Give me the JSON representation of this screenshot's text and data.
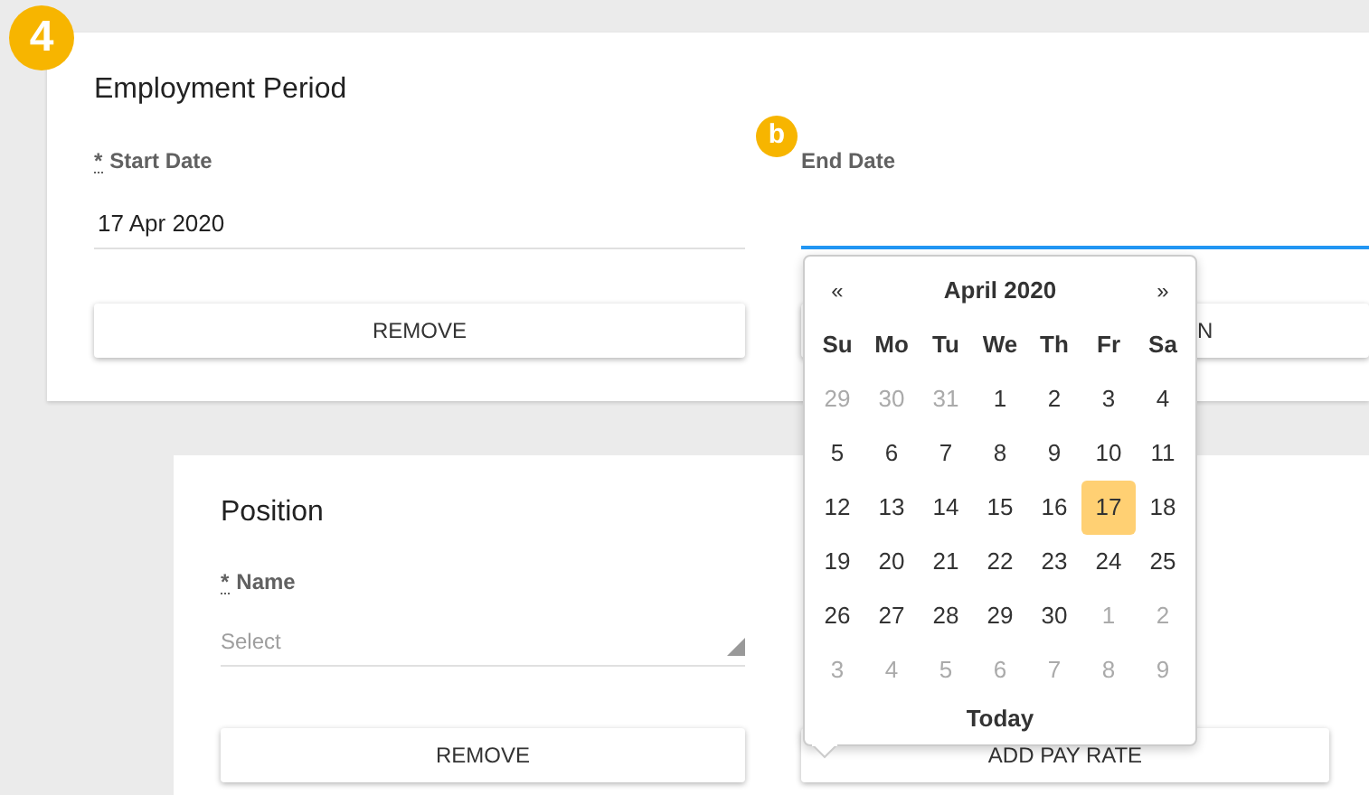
{
  "step_badge": "4",
  "field_badge": "b",
  "employment_period": {
    "title": "Employment Period",
    "start_date": {
      "required_mark": "*",
      "label": "Start Date",
      "value": "17 Apr 2020"
    },
    "end_date": {
      "label": "End Date",
      "focused": true
    },
    "remove_button": "REMOVE",
    "right_button": "N"
  },
  "position": {
    "title": "Position",
    "name": {
      "required_mark": "*",
      "label": "Name",
      "placeholder": "Select"
    },
    "remove_button": "REMOVE",
    "right_button": "ADD PAY RATE"
  },
  "datepicker": {
    "prev": "«",
    "month": "April 2020",
    "next": "»",
    "weekdays": [
      "Su",
      "Mo",
      "Tu",
      "We",
      "Th",
      "Fr",
      "Sa"
    ],
    "weeks": [
      [
        {
          "day": "29",
          "outside": true,
          "selected": false
        },
        {
          "day": "30",
          "outside": true,
          "selected": false
        },
        {
          "day": "31",
          "outside": true,
          "selected": false
        },
        {
          "day": "1",
          "outside": false,
          "selected": false
        },
        {
          "day": "2",
          "outside": false,
          "selected": false
        },
        {
          "day": "3",
          "outside": false,
          "selected": false
        },
        {
          "day": "4",
          "outside": false,
          "selected": false
        }
      ],
      [
        {
          "day": "5",
          "outside": false,
          "selected": false
        },
        {
          "day": "6",
          "outside": false,
          "selected": false
        },
        {
          "day": "7",
          "outside": false,
          "selected": false
        },
        {
          "day": "8",
          "outside": false,
          "selected": false
        },
        {
          "day": "9",
          "outside": false,
          "selected": false
        },
        {
          "day": "10",
          "outside": false,
          "selected": false
        },
        {
          "day": "11",
          "outside": false,
          "selected": false
        }
      ],
      [
        {
          "day": "12",
          "outside": false,
          "selected": false
        },
        {
          "day": "13",
          "outside": false,
          "selected": false
        },
        {
          "day": "14",
          "outside": false,
          "selected": false
        },
        {
          "day": "15",
          "outside": false,
          "selected": false
        },
        {
          "day": "16",
          "outside": false,
          "selected": false
        },
        {
          "day": "17",
          "outside": false,
          "selected": true
        },
        {
          "day": "18",
          "outside": false,
          "selected": false
        }
      ],
      [
        {
          "day": "19",
          "outside": false,
          "selected": false
        },
        {
          "day": "20",
          "outside": false,
          "selected": false
        },
        {
          "day": "21",
          "outside": false,
          "selected": false
        },
        {
          "day": "22",
          "outside": false,
          "selected": false
        },
        {
          "day": "23",
          "outside": false,
          "selected": false
        },
        {
          "day": "24",
          "outside": false,
          "selected": false
        },
        {
          "day": "25",
          "outside": false,
          "selected": false
        }
      ],
      [
        {
          "day": "26",
          "outside": false,
          "selected": false
        },
        {
          "day": "27",
          "outside": false,
          "selected": false
        },
        {
          "day": "28",
          "outside": false,
          "selected": false
        },
        {
          "day": "29",
          "outside": false,
          "selected": false
        },
        {
          "day": "30",
          "outside": false,
          "selected": false
        },
        {
          "day": "1",
          "outside": true,
          "selected": false
        },
        {
          "day": "2",
          "outside": true,
          "selected": false
        }
      ],
      [
        {
          "day": "3",
          "outside": true,
          "selected": false
        },
        {
          "day": "4",
          "outside": true,
          "selected": false
        },
        {
          "day": "5",
          "outside": true,
          "selected": false
        },
        {
          "day": "6",
          "outside": true,
          "selected": false
        },
        {
          "day": "7",
          "outside": true,
          "selected": false
        },
        {
          "day": "8",
          "outside": true,
          "selected": false
        },
        {
          "day": "9",
          "outside": true,
          "selected": false
        }
      ]
    ],
    "today": "Today"
  }
}
